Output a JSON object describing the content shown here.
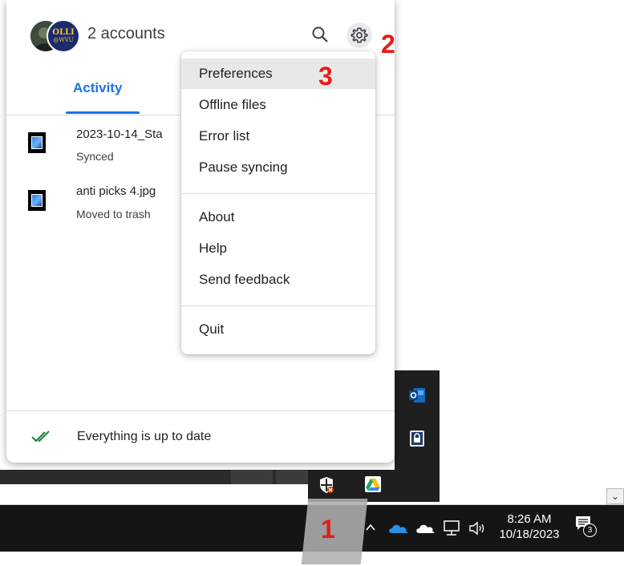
{
  "header": {
    "avatar_line1": "OLLI",
    "avatar_line2": "@WVU",
    "accounts_label": "2 accounts",
    "search_icon": "search-icon",
    "settings_icon": "gear-icon"
  },
  "tabs": {
    "activity_label": "Activity"
  },
  "files": [
    {
      "name": "2023-10-14_Sta",
      "status": "Synced",
      "icon": "image-file-icon"
    },
    {
      "name": "anti picks 4.jpg",
      "status": "Moved to trash",
      "icon": "image-file-icon"
    }
  ],
  "footer": {
    "status_text": "Everything is up to date",
    "status_icon": "double-check-icon",
    "status_color": "#188038"
  },
  "menu": {
    "groups": [
      [
        "Preferences",
        "Offline files",
        "Error list",
        "Pause syncing"
      ],
      [
        "About",
        "Help",
        "Send feedback"
      ],
      [
        "Quit"
      ]
    ],
    "highlighted": "Preferences"
  },
  "annotations": {
    "step1": "1",
    "step2": "2",
    "step3": "3",
    "color": "#e41b17"
  },
  "taskbar": {
    "time": "8:26 AM",
    "date": "10/18/2023",
    "notification_count": "3",
    "icons": [
      "show-hidden-icons-chevron",
      "onedrive-icon",
      "onedrive-personal-icon",
      "network-icon",
      "volume-icon"
    ]
  },
  "tray_overflow": {
    "icons": [
      "outlook-icon",
      "lock-icon",
      "windows-security-icon",
      "google-drive-icon"
    ]
  },
  "accent_color": "#1a73e8"
}
